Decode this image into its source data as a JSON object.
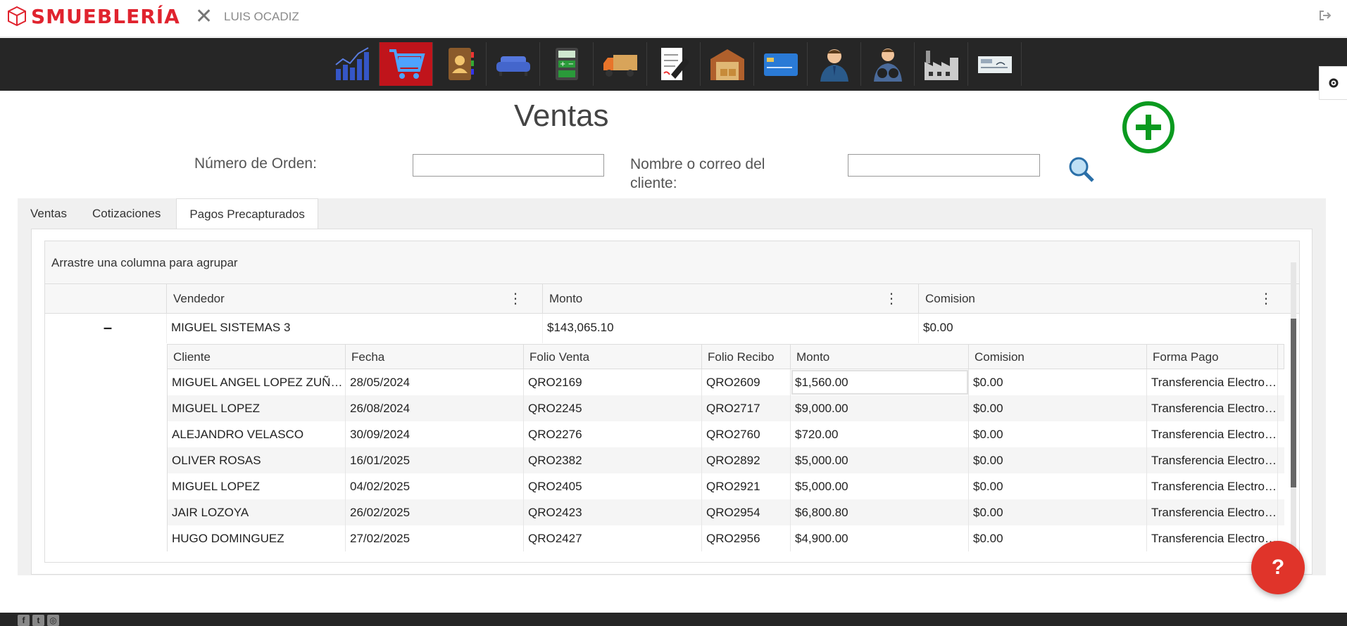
{
  "header": {
    "brand": "SMUEBLERÍA",
    "close_glyph": "✕",
    "user_name": "LUIS OCADIZ",
    "logout_icon": "sign-out-icon"
  },
  "nav": {
    "items": [
      {
        "name": "reports",
        "icon": "bar-chart-icon"
      },
      {
        "name": "sales",
        "icon": "shopping-cart-icon",
        "active": true
      },
      {
        "name": "contacts",
        "icon": "address-book-icon"
      },
      {
        "name": "furniture",
        "icon": "sofa-icon"
      },
      {
        "name": "calculator",
        "icon": "calculator-icon"
      },
      {
        "name": "delivery",
        "icon": "truck-icon"
      },
      {
        "name": "documents",
        "icon": "document-pen-icon"
      },
      {
        "name": "warehouse",
        "icon": "warehouse-icon"
      },
      {
        "name": "payments",
        "icon": "credit-card-icon"
      },
      {
        "name": "employees",
        "icon": "businessman-icon"
      },
      {
        "name": "supervision",
        "icon": "binoculars-man-icon"
      },
      {
        "name": "factory",
        "icon": "factory-icon"
      },
      {
        "name": "checks",
        "icon": "check-icon"
      }
    ]
  },
  "page": {
    "title": "Ventas",
    "order_label": "Número de Orden:",
    "order_value": "",
    "client_label": "Nombre o correo del cliente:",
    "client_value": ""
  },
  "tabs": [
    "Ventas",
    "Cotizaciones",
    "Pagos Precapturados"
  ],
  "grid": {
    "group_hint": "Arrastre una columna para agrupar",
    "columns": [
      "Vendedor",
      "Monto",
      "Comision"
    ],
    "master": {
      "vendedor": "MIGUEL SISTEMAS 3",
      "monto": "$143,065.10",
      "comision": "$0.00",
      "collapse": "–"
    },
    "detail_columns": [
      "Cliente",
      "Fecha",
      "Folio Venta",
      "Folio Recibo",
      "Monto",
      "Comision",
      "Forma Pago"
    ],
    "detail_rows": [
      [
        "MIGUEL ANGEL LOPEZ ZUÑIGA",
        "28/05/2024",
        "QRO2169",
        "QRO2609",
        "$1,560.00",
        "$0.00",
        "Transferencia Electronica"
      ],
      [
        "MIGUEL LOPEZ",
        "26/08/2024",
        "QRO2245",
        "QRO2717",
        "$9,000.00",
        "$0.00",
        "Transferencia Electronica"
      ],
      [
        "ALEJANDRO VELASCO",
        "30/09/2024",
        "QRO2276",
        "QRO2760",
        "$720.00",
        "$0.00",
        "Transferencia Electronica"
      ],
      [
        "OLIVER ROSAS",
        "16/01/2025",
        "QRO2382",
        "QRO2892",
        "$5,000.00",
        "$0.00",
        "Transferencia Electronica"
      ],
      [
        "MIGUEL LOPEZ",
        "04/02/2025",
        "QRO2405",
        "QRO2921",
        "$5,000.00",
        "$0.00",
        "Transferencia Electronica"
      ],
      [
        "JAIR LOZOYA",
        "26/02/2025",
        "QRO2423",
        "QRO2954",
        "$6,800.80",
        "$0.00",
        "Transferencia Electronica"
      ],
      [
        "HUGO DOMINGUEZ",
        "27/02/2025",
        "QRO2427",
        "QRO2956",
        "$4,900.00",
        "$0.00",
        "Transferencia Electronica"
      ]
    ]
  },
  "help": {
    "label": "?"
  },
  "colors": {
    "brand_red": "#e0232e",
    "nav_bg": "#262626",
    "active_nav": "#c0141b",
    "add_green": "#0a9a1f",
    "help_red": "#e0342a"
  }
}
